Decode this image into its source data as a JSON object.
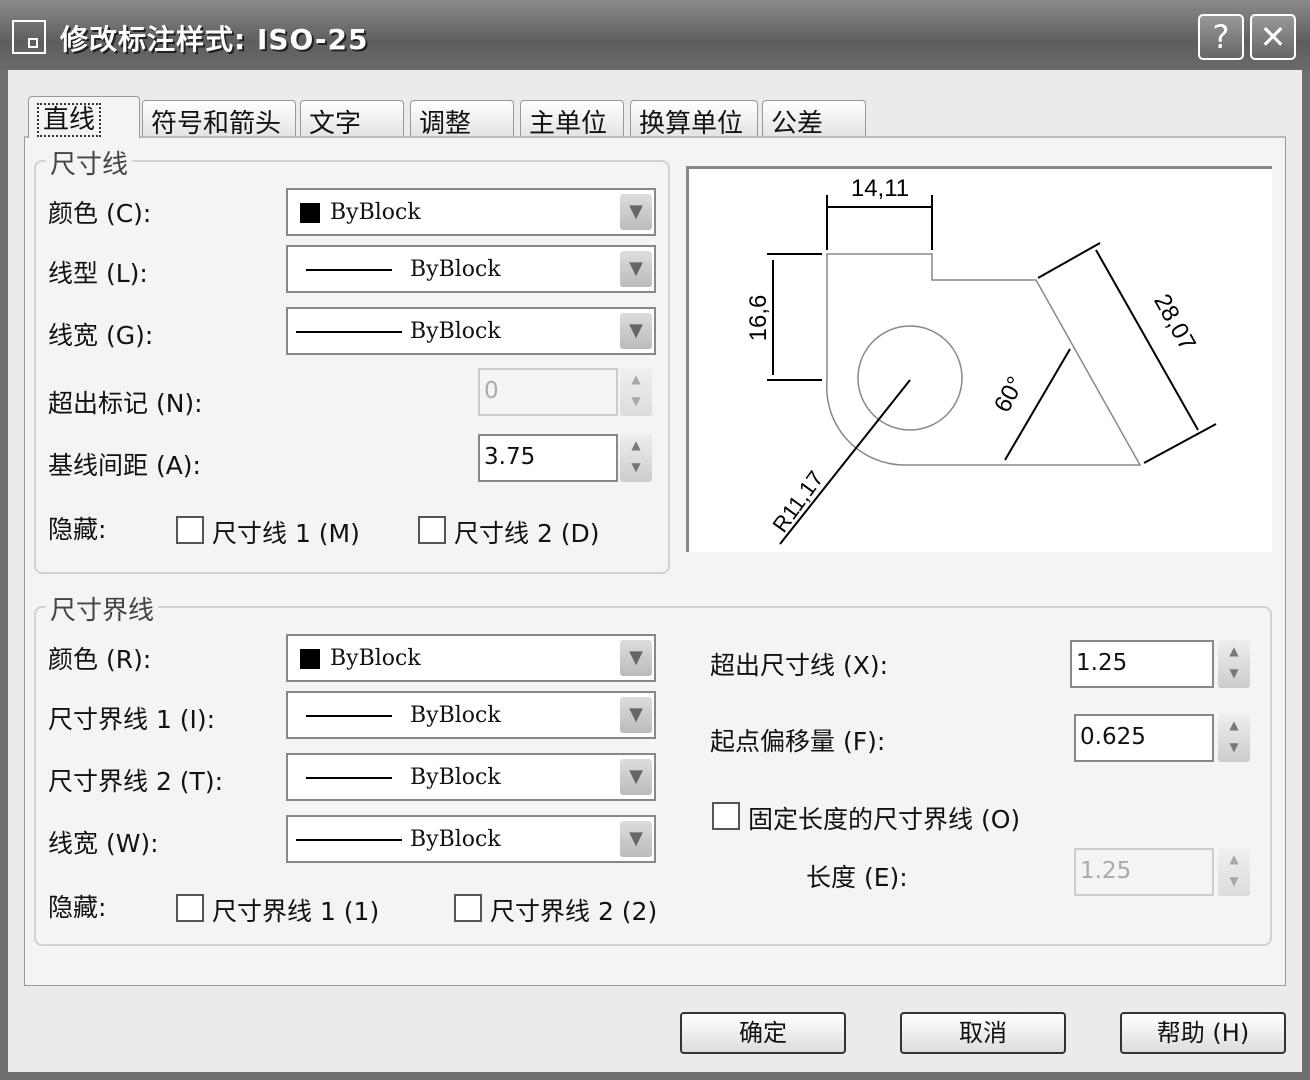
{
  "window": {
    "title": "修改标注样式: ISO-25",
    "help_btn": "?",
    "close_btn": "✕"
  },
  "tabs": [
    "直线",
    "符号和箭头",
    "文字",
    "调整",
    "主单位",
    "换算单位",
    "公差"
  ],
  "dim_lines": {
    "title": "尺寸线",
    "color_label": "颜色 (C):",
    "color_value": "ByBlock",
    "linetype_label": "线型 (L):",
    "linetype_value": "ByBlock",
    "lineweight_label": "线宽 (G):",
    "lineweight_value": "ByBlock",
    "extend_label": "超出标记 (N):",
    "extend_value": "0",
    "baseline_label": "基线间距 (A):",
    "baseline_value": "3.75",
    "suppress_label": "隐藏:",
    "suppress1": "尺寸线 1 (M)",
    "suppress2": "尺寸线 2 (D)"
  },
  "ext_lines": {
    "title": "尺寸界线",
    "color_label": "颜色 (R):",
    "color_value": "ByBlock",
    "lt1_label": "尺寸界线 1 (I):",
    "lt1_value": "ByBlock",
    "lt2_label": "尺寸界线 2 (T):",
    "lt2_value": "ByBlock",
    "lw_label": "线宽 (W):",
    "lw_value": "ByBlock",
    "suppress_label": "隐藏:",
    "suppress1": "尺寸界线 1 (1)",
    "suppress2": "尺寸界线 2 (2)",
    "beyond_label": "超出尺寸线 (X):",
    "beyond_value": "1.25",
    "offset_label": "起点偏移量 (F):",
    "offset_value": "0.625",
    "fixed_label": "固定长度的尺寸界线 (O)",
    "length_label": "长度 (E):",
    "length_value": "1.25"
  },
  "preview": {
    "dim_top": "14,11",
    "dim_left": "16,6",
    "dim_slant": "28,07",
    "dim_angle": "60°",
    "dim_radius": "R11,17"
  },
  "buttons": {
    "ok": "确定",
    "cancel": "取消",
    "help": "帮助 (H)"
  }
}
